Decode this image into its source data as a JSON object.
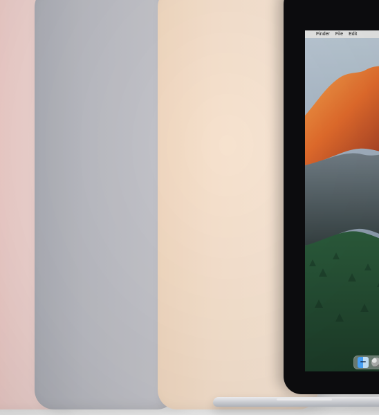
{
  "menubar": {
    "apple_symbol": "",
    "items": [
      "Finder",
      "File",
      "Edit"
    ]
  },
  "colors": {
    "rose": "#F2CFCB",
    "gray": "#BDBDC3",
    "gold": "#F6E0CC",
    "bezel": "#0C0C0E"
  }
}
